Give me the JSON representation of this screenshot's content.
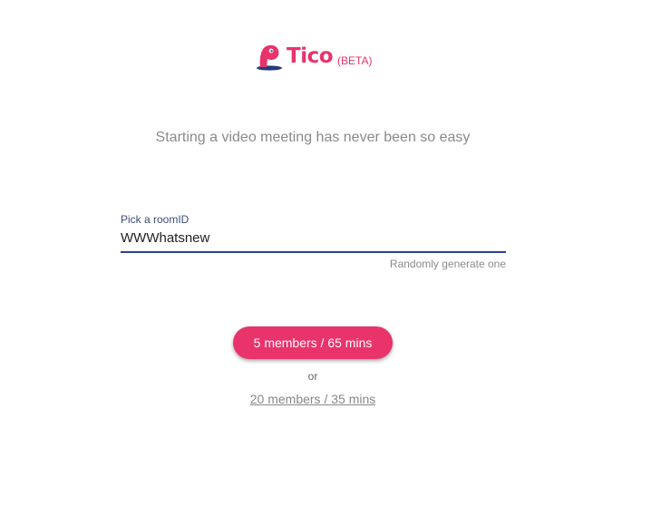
{
  "brand": {
    "name": "Tico",
    "badge": "(BETA)",
    "color": "#e8336b",
    "icon": "bird-logo-icon"
  },
  "tagline": "Starting a video meeting has never been so easy",
  "room": {
    "label": "Pick a roomID",
    "value": "WWWhatsnew",
    "random_link": "Randomly generate one"
  },
  "actions": {
    "primary_label": "5 members / 65 mins",
    "or_text": "or",
    "secondary_label": "20 members / 35 mins"
  },
  "colors": {
    "accent": "#e8336b",
    "input_underline": "#2b3f8f",
    "muted_text": "#8a8a8a"
  }
}
